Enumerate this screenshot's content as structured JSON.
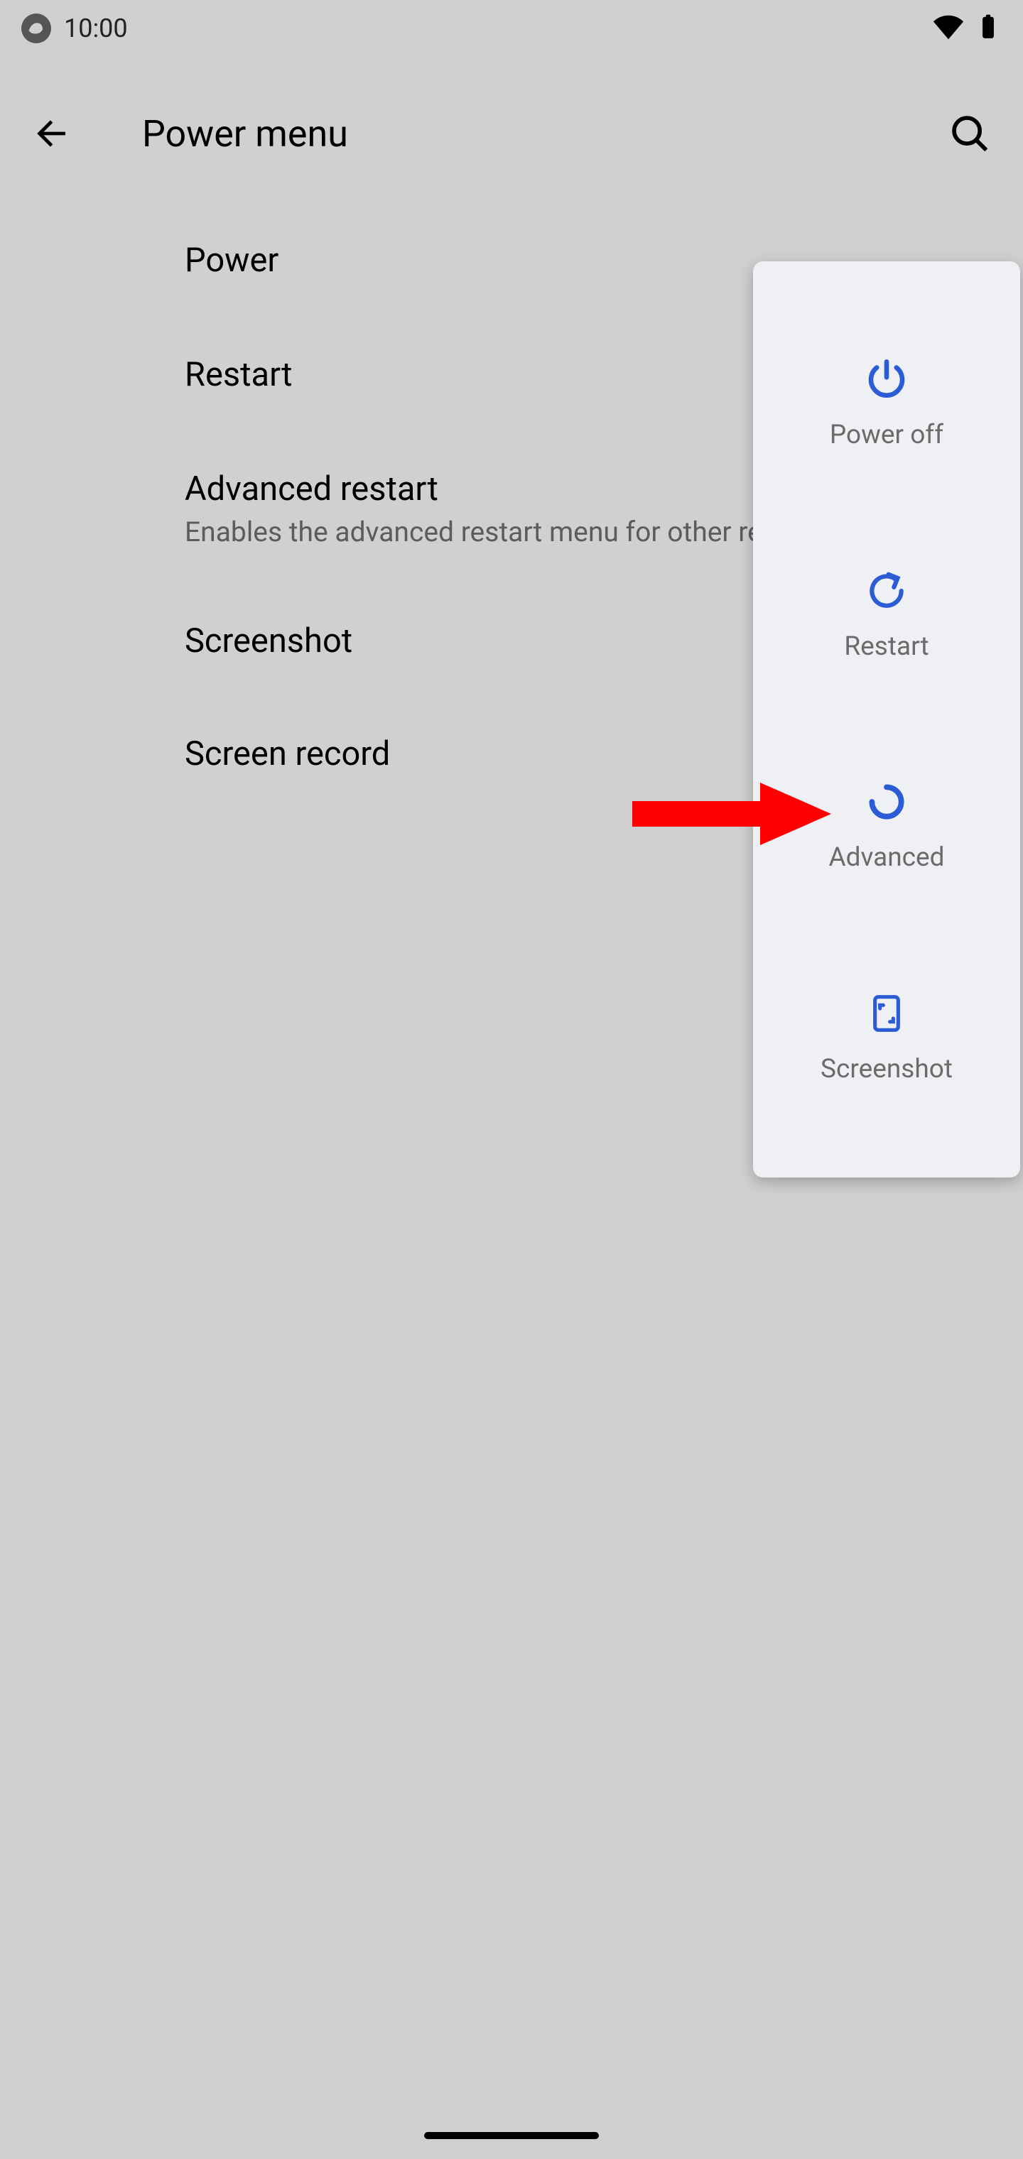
{
  "status": {
    "time": "10:00"
  },
  "header": {
    "title": "Power menu"
  },
  "settings": {
    "power": {
      "title": "Power"
    },
    "restart": {
      "title": "Restart"
    },
    "advanced_restart": {
      "title": "Advanced restart",
      "sub": "Enables the advanced restart menu for other restarting options"
    },
    "screenshot": {
      "title": "Screenshot"
    },
    "screen_record": {
      "title": "Screen record"
    }
  },
  "popup": {
    "power_off": "Power off",
    "restart": "Restart",
    "advanced": "Advanced",
    "screenshot": "Screenshot"
  },
  "colors": {
    "accent": "#2b5cd6",
    "arrow": "#ff0000"
  }
}
